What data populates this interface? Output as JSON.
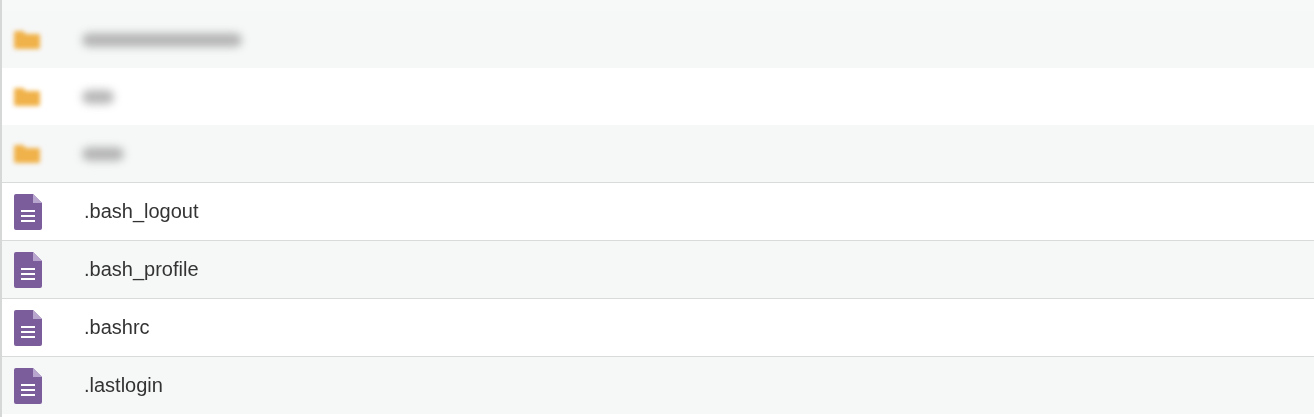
{
  "files": [
    {
      "kind": "folder",
      "redacted": true
    },
    {
      "kind": "folder",
      "redacted": true
    },
    {
      "kind": "folder",
      "redacted": true
    },
    {
      "kind": "file",
      "name": ".bash_logout"
    },
    {
      "kind": "file",
      "name": ".bash_profile"
    },
    {
      "kind": "file",
      "name": ".bashrc"
    },
    {
      "kind": "file",
      "name": ".lastlogin"
    }
  ]
}
